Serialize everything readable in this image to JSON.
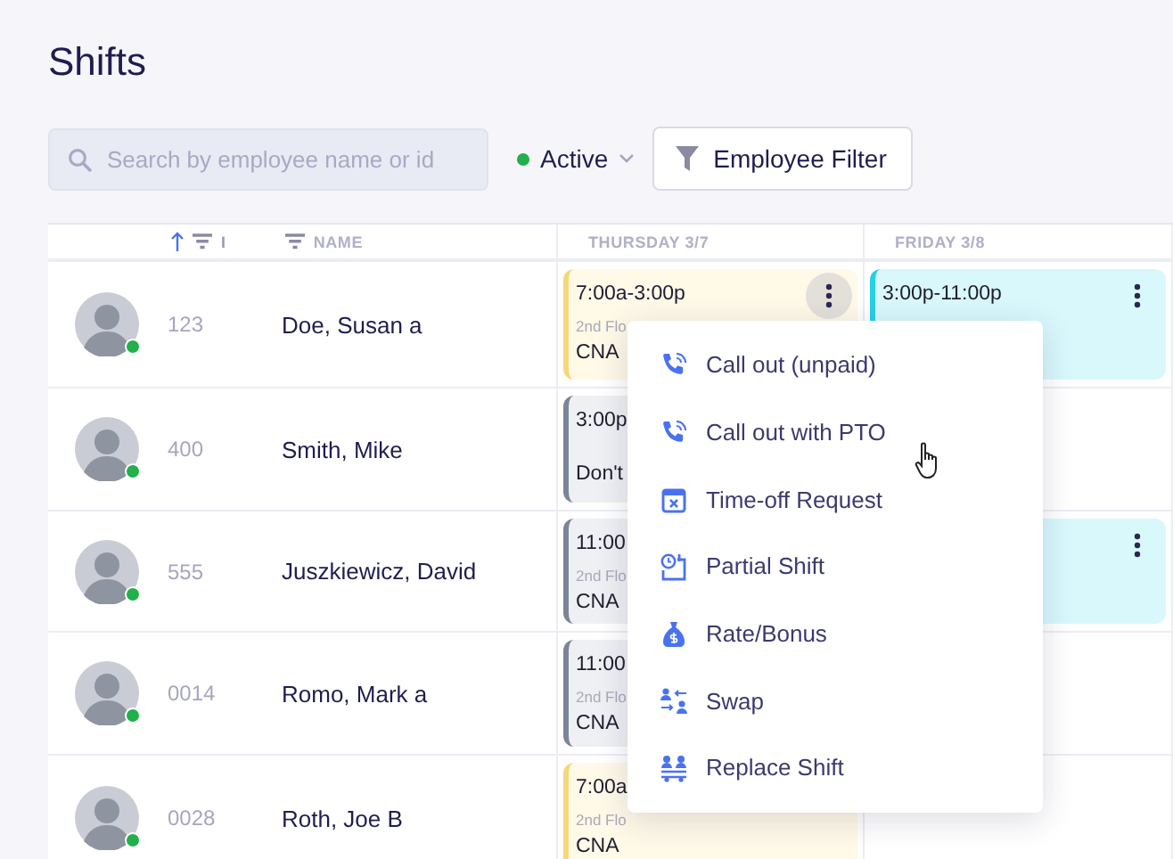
{
  "title": "Shifts",
  "search": {
    "placeholder": "Search by employee name or id"
  },
  "status_filter": {
    "label": "Active",
    "color": "#22b04a"
  },
  "filter_button": {
    "label": "Employee Filter"
  },
  "table": {
    "columns": [
      {
        "kind": "id",
        "label": "I",
        "sorted": true
      },
      {
        "kind": "name",
        "label": "NAME",
        "sorted": false
      },
      {
        "kind": "day",
        "label": "THURSDAY 3/7"
      },
      {
        "kind": "day",
        "label": "FRIDAY 3/8"
      }
    ],
    "rows": [
      {
        "id": "123",
        "name": "Doe, Susan a",
        "online": true,
        "shifts": [
          {
            "kind": "pending",
            "time": "7:00a-3:00p",
            "location": "2nd Flo",
            "role": "CNA",
            "menu_open": true
          },
          {
            "kind": "open",
            "time": "3:00p-11:00p",
            "menu_open": false
          }
        ]
      },
      {
        "id": "400",
        "name": "Smith, Mike",
        "online": true,
        "shifts": [
          {
            "kind": "off",
            "time": "3:00p",
            "note": "Don't"
          }
        ]
      },
      {
        "id": "555",
        "name": "Juszkiewicz, David",
        "online": true,
        "shifts": [
          {
            "kind": "off",
            "time": "11:00",
            "location": "2nd Flo",
            "role": "CNA"
          },
          {
            "kind": "open",
            "menu_open": false
          }
        ]
      },
      {
        "id": "0014",
        "name": "Romo, Mark a",
        "online": true,
        "shifts": [
          {
            "kind": "off",
            "time": "11:00",
            "location": "2nd Flo",
            "role": "CNA"
          }
        ]
      },
      {
        "id": "0028",
        "name": "Roth, Joe B",
        "online": true,
        "shifts": [
          {
            "kind": "pending",
            "time": "7:00a",
            "location": "2nd Flo",
            "role": "CNA"
          }
        ]
      }
    ]
  },
  "menu": {
    "items": [
      {
        "kind": "call",
        "label": "Call out (unpaid)"
      },
      {
        "kind": "call",
        "label": "Call out with PTO"
      },
      {
        "kind": "timeoff",
        "label": "Time-off Request"
      },
      {
        "kind": "partial",
        "label": "Partial Shift"
      },
      {
        "kind": "bonus",
        "label": "Rate/Bonus"
      },
      {
        "kind": "swap",
        "label": "Swap"
      },
      {
        "kind": "replace",
        "label": "Replace Shift"
      }
    ]
  }
}
